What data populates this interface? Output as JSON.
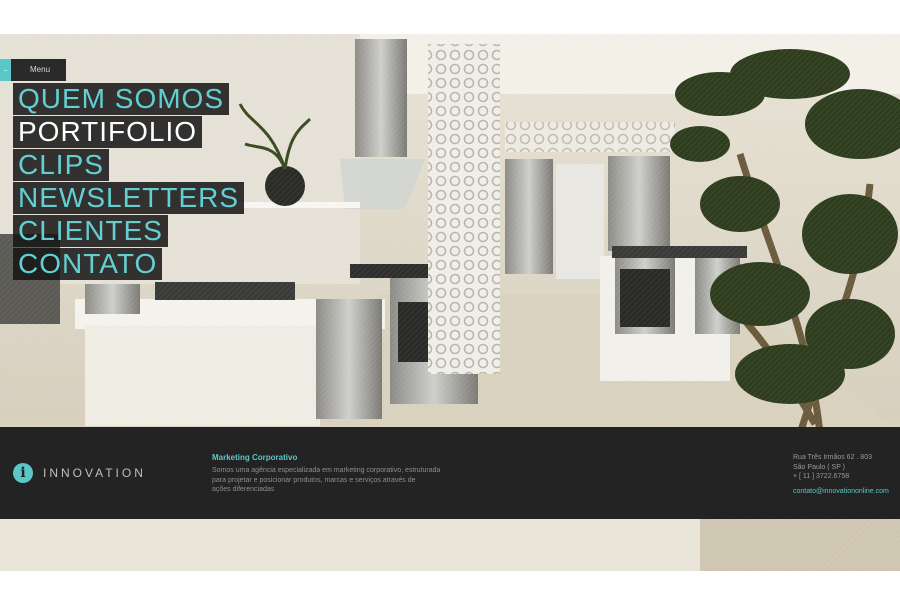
{
  "menu": {
    "toggle_glyph": "-",
    "label": "Menu"
  },
  "nav": {
    "items": [
      {
        "label": "QUEM SOMOS"
      },
      {
        "label": "PORTIFOLIO"
      },
      {
        "label": "CLIPS"
      },
      {
        "label": "NEWSLETTERS"
      },
      {
        "label": "CLIENTES"
      },
      {
        "label": "CONTATO"
      }
    ]
  },
  "footer": {
    "logo": {
      "icon_glyph": "i",
      "brand": "INNOVATION"
    },
    "marketing": {
      "title": "Marketing Corporativo",
      "line1": "Somos uma agência especializada em marketing corporativo, estruturada",
      "line2": "para projetar e posicionar produtos, marcas e serviços através de",
      "line3": "ações diferenciadas"
    },
    "contact": {
      "street": "Rua Três Irmãos 62 . 803",
      "city": "São Paulo ( SP )",
      "phone": "+ [ 11 ] 3722.6758",
      "email": "contato@innovationonline.com"
    }
  },
  "colors": {
    "accent": "#5bc7c9",
    "bar": "#232323",
    "nav_bg": "#141414"
  },
  "background": {
    "subject": "modern white kitchen showroom with stainless appliances and a potted tree"
  }
}
